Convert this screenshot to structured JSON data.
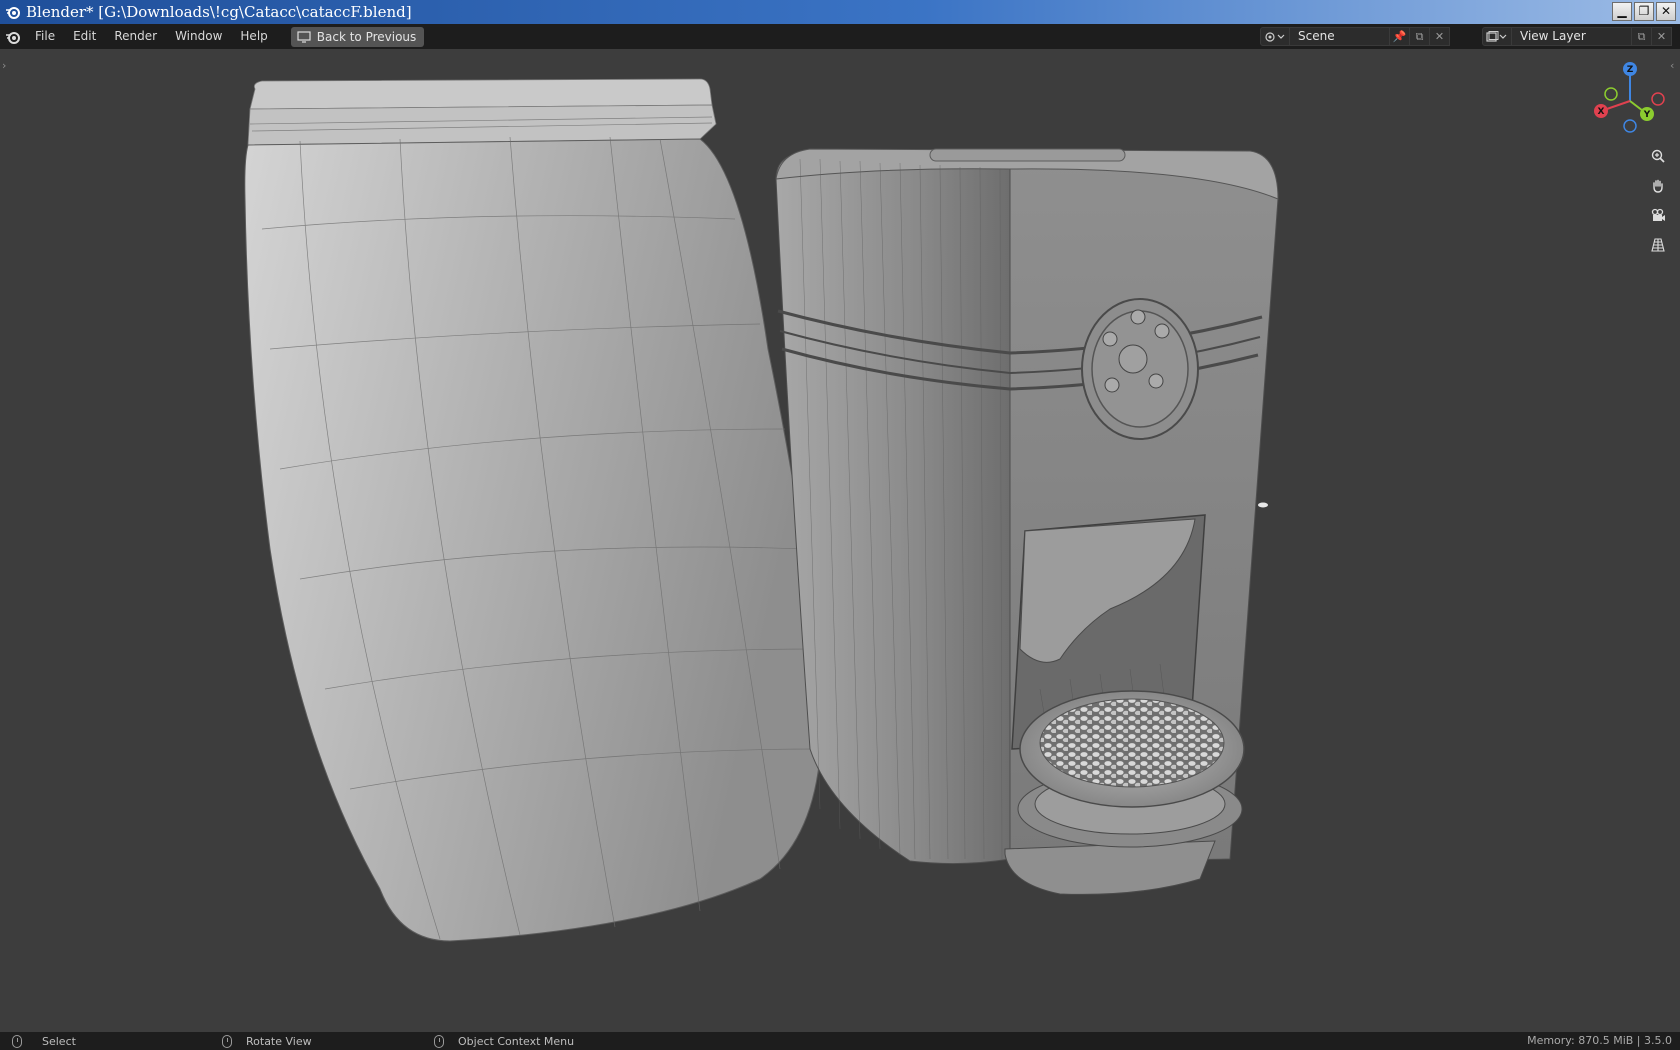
{
  "window": {
    "title": "Blender* [G:\\Downloads\\!cg\\Catacc\\cataccF.blend]",
    "controls": {
      "minimize": "▁",
      "restore": "❐",
      "close": "✕"
    }
  },
  "menubar": {
    "items": [
      "File",
      "Edit",
      "Render",
      "Window",
      "Help"
    ],
    "back_button": "Back to Previous",
    "scene_field": "Scene",
    "view_layer_field": "View Layer"
  },
  "viewport": {
    "gizmo_axes": {
      "x": "X",
      "y": "Y",
      "z": "Z"
    },
    "colors": {
      "background": "#3d3d3d",
      "axis_x": "#e0414f",
      "axis_y": "#8ccc2f",
      "axis_z": "#3f86e3"
    }
  },
  "statusbar": {
    "select": "Select",
    "rotate": "Rotate View",
    "context_menu": "Object Context Menu",
    "memory": "Memory: 870.5 MiB | 3.5.0"
  }
}
